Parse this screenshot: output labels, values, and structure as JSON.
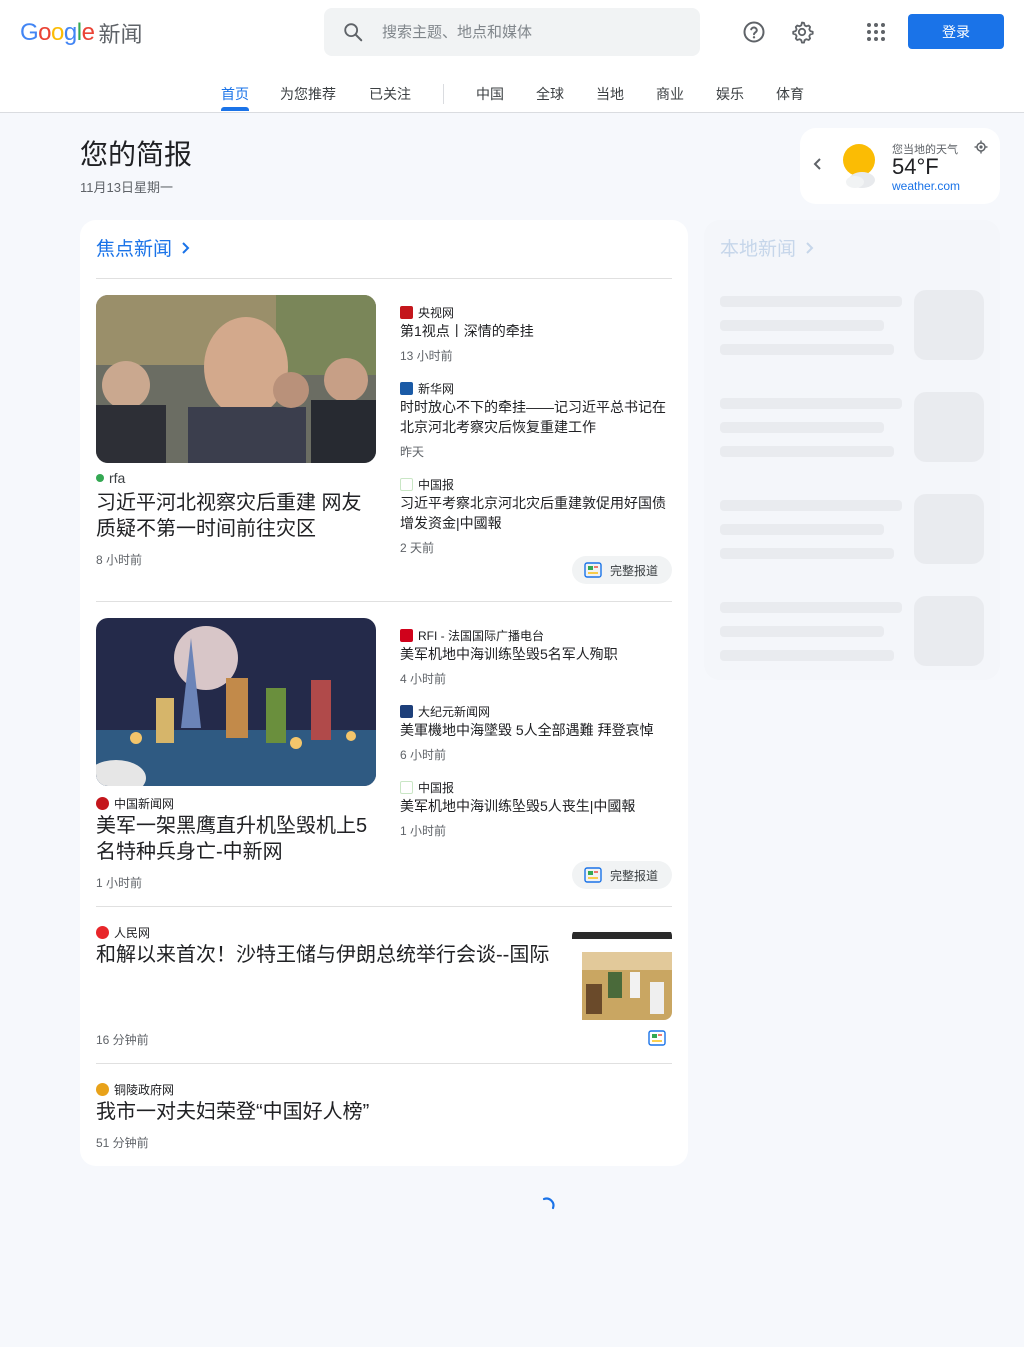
{
  "header": {
    "logo_word": "Google",
    "logo_product": "新闻",
    "search_placeholder": "搜索主题、地点和媒体",
    "login_label": "登录",
    "icons": [
      "search-icon",
      "help-icon",
      "settings-icon",
      "apps-icon"
    ]
  },
  "nav": {
    "tabs": [
      "首页",
      "为您推荐",
      "已关注",
      "中国",
      "全球",
      "当地",
      "商业",
      "娱乐",
      "体育"
    ],
    "active": "首页"
  },
  "briefing": {
    "title": "您的简报",
    "date": "11月13日星期一"
  },
  "weather": {
    "label": "您当地的天气",
    "temp": "54°F",
    "source": "weather.com"
  },
  "top_stories": {
    "title": "焦点新闻",
    "clusters": [
      {
        "main": {
          "source": "rfa",
          "title": "习近平河北视察灾后重建 网友质疑不第一时间前往灾区",
          "time": "8 小时前"
        },
        "related": [
          {
            "source": "央视网",
            "title": "第1视点丨深情的牵挂",
            "time": "13 小时前"
          },
          {
            "source": "新华网",
            "title": "时时放心不下的牵挂——记习近平总书记在北京河北考察灾后恢复重建工作",
            "time": "昨天"
          },
          {
            "source": "中国报",
            "title": "习近平考察北京河北灾后重建敦促用好国债增发资金|中國報",
            "time": "2 天前"
          }
        ],
        "full_coverage": "完整报道"
      },
      {
        "main": {
          "source": "中国新闻网",
          "title": "美军一架黑鹰直升机坠毁机上5名特种兵身亡-中新网",
          "time": "1 小时前"
        },
        "related": [
          {
            "source": "RFI - 法国国际广播电台",
            "title": "美军机地中海训练坠毁5名军人殉职",
            "time": "4 小时前"
          },
          {
            "source": "大纪元新闻网",
            "title": "美軍機地中海墜毀 5人全部遇難 拜登哀悼",
            "time": "6 小时前"
          },
          {
            "source": "中国报",
            "title": "美军机地中海训练坠毁5人丧生|中國報",
            "time": "1 小时前"
          }
        ],
        "full_coverage": "完整报道"
      }
    ],
    "singles": [
      {
        "source": "人民网",
        "title": "和解以来首次！沙特王储与伊朗总统举行会谈--国际",
        "time": "16 分钟前"
      },
      {
        "source": "铜陵政府网",
        "title": "我市一对夫妇荣登“中国好人榜”",
        "time": "51 分钟前"
      }
    ]
  },
  "local_news": {
    "title": "本地新闻"
  },
  "colors": {
    "accent": "#1a73e8",
    "background": "#f6f8fc",
    "card": "#ffffff"
  }
}
